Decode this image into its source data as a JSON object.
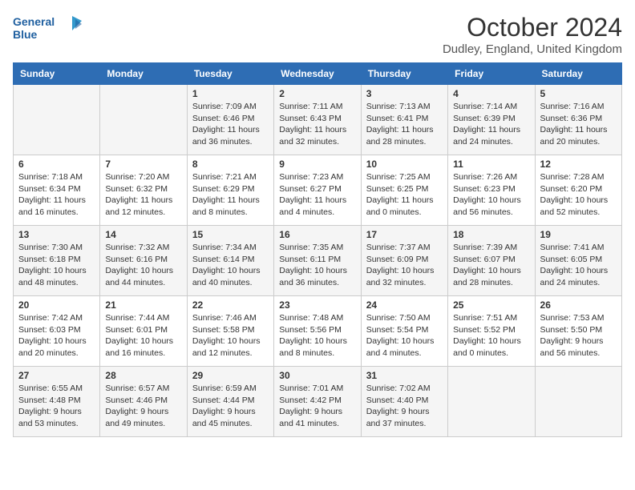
{
  "header": {
    "logo_line1": "General",
    "logo_line2": "Blue",
    "month_title": "October 2024",
    "location": "Dudley, England, United Kingdom"
  },
  "days_of_week": [
    "Sunday",
    "Monday",
    "Tuesday",
    "Wednesday",
    "Thursday",
    "Friday",
    "Saturday"
  ],
  "weeks": [
    [
      {
        "day": "",
        "info": ""
      },
      {
        "day": "",
        "info": ""
      },
      {
        "day": "1",
        "info": "Sunrise: 7:09 AM\nSunset: 6:46 PM\nDaylight: 11 hours\nand 36 minutes."
      },
      {
        "day": "2",
        "info": "Sunrise: 7:11 AM\nSunset: 6:43 PM\nDaylight: 11 hours\nand 32 minutes."
      },
      {
        "day": "3",
        "info": "Sunrise: 7:13 AM\nSunset: 6:41 PM\nDaylight: 11 hours\nand 28 minutes."
      },
      {
        "day": "4",
        "info": "Sunrise: 7:14 AM\nSunset: 6:39 PM\nDaylight: 11 hours\nand 24 minutes."
      },
      {
        "day": "5",
        "info": "Sunrise: 7:16 AM\nSunset: 6:36 PM\nDaylight: 11 hours\nand 20 minutes."
      }
    ],
    [
      {
        "day": "6",
        "info": "Sunrise: 7:18 AM\nSunset: 6:34 PM\nDaylight: 11 hours\nand 16 minutes."
      },
      {
        "day": "7",
        "info": "Sunrise: 7:20 AM\nSunset: 6:32 PM\nDaylight: 11 hours\nand 12 minutes."
      },
      {
        "day": "8",
        "info": "Sunrise: 7:21 AM\nSunset: 6:29 PM\nDaylight: 11 hours\nand 8 minutes."
      },
      {
        "day": "9",
        "info": "Sunrise: 7:23 AM\nSunset: 6:27 PM\nDaylight: 11 hours\nand 4 minutes."
      },
      {
        "day": "10",
        "info": "Sunrise: 7:25 AM\nSunset: 6:25 PM\nDaylight: 11 hours\nand 0 minutes."
      },
      {
        "day": "11",
        "info": "Sunrise: 7:26 AM\nSunset: 6:23 PM\nDaylight: 10 hours\nand 56 minutes."
      },
      {
        "day": "12",
        "info": "Sunrise: 7:28 AM\nSunset: 6:20 PM\nDaylight: 10 hours\nand 52 minutes."
      }
    ],
    [
      {
        "day": "13",
        "info": "Sunrise: 7:30 AM\nSunset: 6:18 PM\nDaylight: 10 hours\nand 48 minutes."
      },
      {
        "day": "14",
        "info": "Sunrise: 7:32 AM\nSunset: 6:16 PM\nDaylight: 10 hours\nand 44 minutes."
      },
      {
        "day": "15",
        "info": "Sunrise: 7:34 AM\nSunset: 6:14 PM\nDaylight: 10 hours\nand 40 minutes."
      },
      {
        "day": "16",
        "info": "Sunrise: 7:35 AM\nSunset: 6:11 PM\nDaylight: 10 hours\nand 36 minutes."
      },
      {
        "day": "17",
        "info": "Sunrise: 7:37 AM\nSunset: 6:09 PM\nDaylight: 10 hours\nand 32 minutes."
      },
      {
        "day": "18",
        "info": "Sunrise: 7:39 AM\nSunset: 6:07 PM\nDaylight: 10 hours\nand 28 minutes."
      },
      {
        "day": "19",
        "info": "Sunrise: 7:41 AM\nSunset: 6:05 PM\nDaylight: 10 hours\nand 24 minutes."
      }
    ],
    [
      {
        "day": "20",
        "info": "Sunrise: 7:42 AM\nSunset: 6:03 PM\nDaylight: 10 hours\nand 20 minutes."
      },
      {
        "day": "21",
        "info": "Sunrise: 7:44 AM\nSunset: 6:01 PM\nDaylight: 10 hours\nand 16 minutes."
      },
      {
        "day": "22",
        "info": "Sunrise: 7:46 AM\nSunset: 5:58 PM\nDaylight: 10 hours\nand 12 minutes."
      },
      {
        "day": "23",
        "info": "Sunrise: 7:48 AM\nSunset: 5:56 PM\nDaylight: 10 hours\nand 8 minutes."
      },
      {
        "day": "24",
        "info": "Sunrise: 7:50 AM\nSunset: 5:54 PM\nDaylight: 10 hours\nand 4 minutes."
      },
      {
        "day": "25",
        "info": "Sunrise: 7:51 AM\nSunset: 5:52 PM\nDaylight: 10 hours\nand 0 minutes."
      },
      {
        "day": "26",
        "info": "Sunrise: 7:53 AM\nSunset: 5:50 PM\nDaylight: 9 hours\nand 56 minutes."
      }
    ],
    [
      {
        "day": "27",
        "info": "Sunrise: 6:55 AM\nSunset: 4:48 PM\nDaylight: 9 hours\nand 53 minutes."
      },
      {
        "day": "28",
        "info": "Sunrise: 6:57 AM\nSunset: 4:46 PM\nDaylight: 9 hours\nand 49 minutes."
      },
      {
        "day": "29",
        "info": "Sunrise: 6:59 AM\nSunset: 4:44 PM\nDaylight: 9 hours\nand 45 minutes."
      },
      {
        "day": "30",
        "info": "Sunrise: 7:01 AM\nSunset: 4:42 PM\nDaylight: 9 hours\nand 41 minutes."
      },
      {
        "day": "31",
        "info": "Sunrise: 7:02 AM\nSunset: 4:40 PM\nDaylight: 9 hours\nand 37 minutes."
      },
      {
        "day": "",
        "info": ""
      },
      {
        "day": "",
        "info": ""
      }
    ]
  ]
}
